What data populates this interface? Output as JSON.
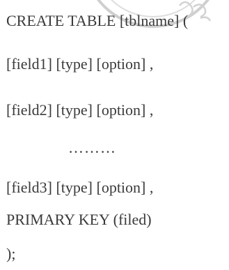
{
  "sql_syntax": {
    "lines": [
      "CREATE TABLE [tblname] (",
      "[field1] [type] [option] ,",
      "[field2] [type] [option] ,",
      "………",
      "[field3] [type] [option] ,",
      "PRIMARY KEY (filed)",
      ");"
    ]
  },
  "watermark": {
    "color": "#c8c8c8"
  }
}
